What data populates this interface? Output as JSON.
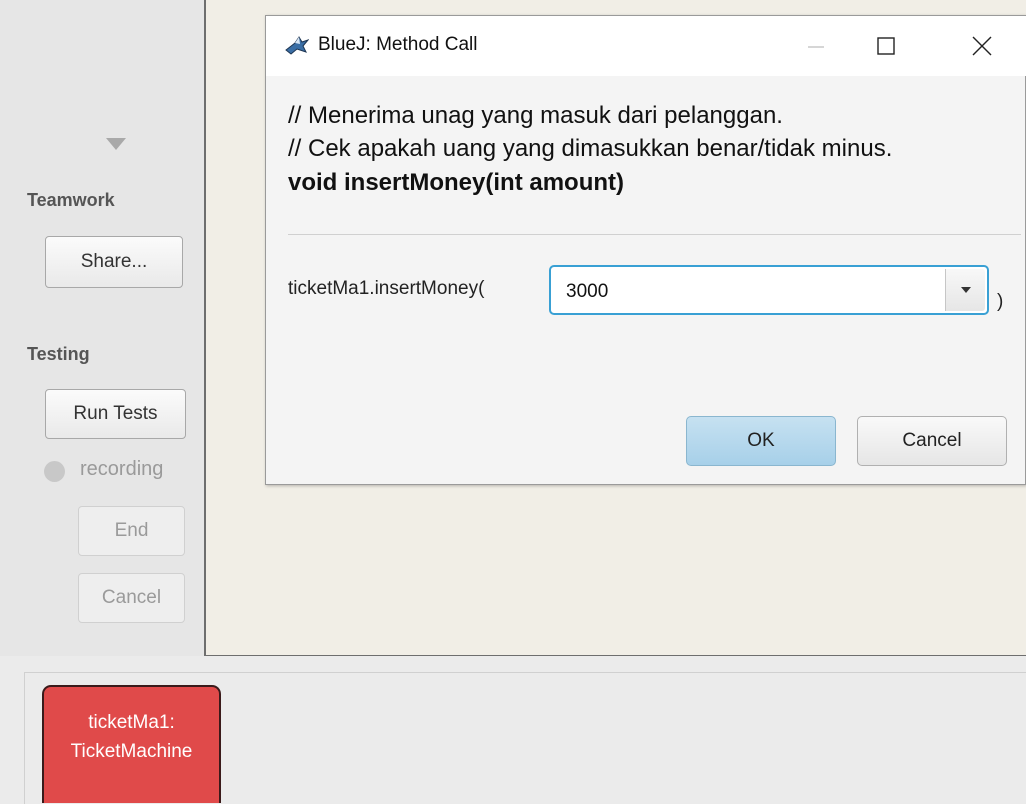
{
  "sidebar": {
    "teamwork_label": "Teamwork",
    "share_button": "Share...",
    "testing_label": "Testing",
    "run_tests_button": "Run Tests",
    "recording_label": "recording",
    "end_button": "End",
    "cancel_button": "Cancel"
  },
  "object_bench": {
    "object_name": "ticketMa1:",
    "object_class": "TicketMachine"
  },
  "dialog": {
    "title": "BlueJ:  Method Call",
    "comment_line1": "// Menerima unag yang masuk dari pelanggan.",
    "comment_line2": "// Cek apakah uang yang dimasukkan benar/tidak minus.",
    "signature": "void insertMoney(int amount)",
    "call_prefix": "ticketMa1.insertMoney(",
    "argument_value": "3000",
    "call_suffix": ")",
    "ok_button": "OK",
    "cancel_button": "Cancel"
  },
  "colors": {
    "object_fill": "#e04a4a",
    "combo_focus": "#39a0d4",
    "ok_fill": "#b5d8ee"
  }
}
